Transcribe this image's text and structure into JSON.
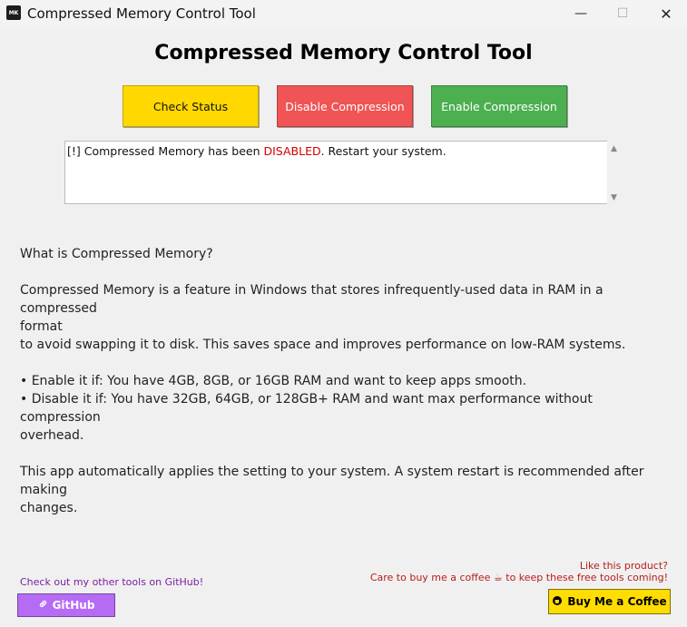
{
  "window": {
    "title": "Compressed Memory Control Tool",
    "icon_label": "MK",
    "minimize_glyph": "—",
    "maximize_glyph": "☐",
    "close_glyph": "✕"
  },
  "header": {
    "title": "Compressed Memory Control Tool"
  },
  "buttons": {
    "check_status": "Check Status",
    "disable": "Disable Compression",
    "enable": "Enable Compression"
  },
  "status_log": {
    "prefix": "[!] Compressed Memory has been ",
    "state": "DISABLED",
    "suffix": ". Restart your system."
  },
  "info": {
    "heading": "What is Compressed Memory?",
    "para1_line1": "Compressed Memory is a feature in Windows that stores infrequently-used data in RAM in a compressed",
    "para1_line2": "format",
    "para1_line3": "to avoid swapping it to disk. This saves space and improves performance on low-RAM systems.",
    "bullet_enable": "• Enable it if: You have 4GB, 8GB, or 16GB RAM and want to keep apps smooth.",
    "bullet_disable_line1": "• Disable it if: You have 32GB, 64GB, or 128GB+ RAM and want max performance without compression",
    "bullet_disable_line2": "overhead.",
    "para3_line1": "This app automatically applies the setting to your system. A system restart is recommended after making",
    "para3_line2": "changes."
  },
  "footer": {
    "github_caption": "Check out my other tools on GitHub!",
    "github_button": "GitHub",
    "like_line1": "Like this product?",
    "like_line2": "Care to buy me a coffee ☕ to keep these free tools coming!",
    "coffee_button": "Buy Me a Coffee"
  },
  "icons": {
    "link": "link-icon",
    "coffee": "coffee-icon"
  },
  "colors": {
    "check_status": "#ffd800",
    "disable": "#f05454",
    "enable": "#4caf50",
    "status_red": "#d40000",
    "github": "#b66bf5",
    "coffee": "#ffdd00"
  }
}
